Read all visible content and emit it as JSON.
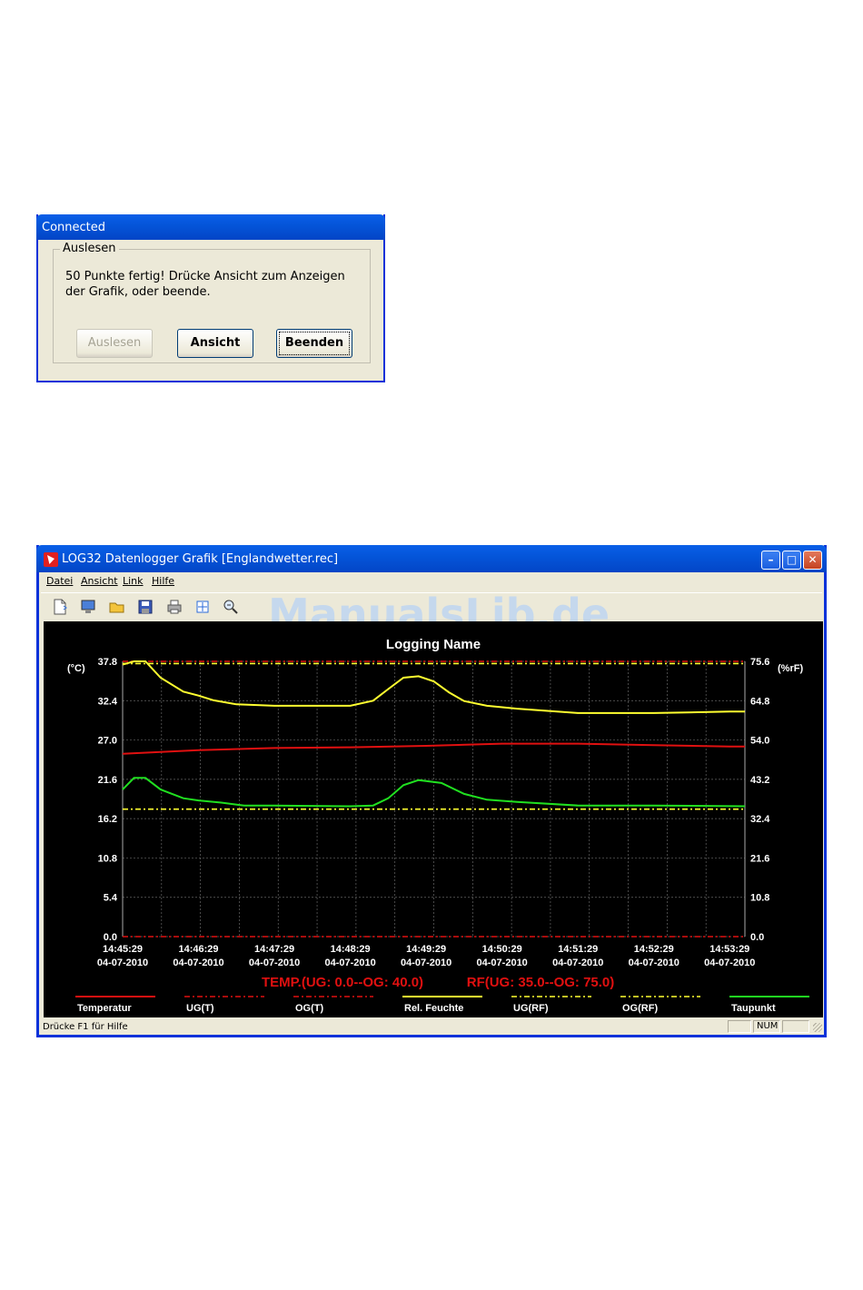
{
  "dialog": {
    "title": "Connected",
    "group_label": "Auslesen",
    "message": "50 Punkte fertig! Drücke Ansicht zum Anzeigen der Grafik, oder beende.",
    "buttons": {
      "read": "Auslesen",
      "view": "Ansicht",
      "exit": "Beenden"
    }
  },
  "window": {
    "title": "LOG32 Datenlogger Grafik [Englandwetter.rec]",
    "menu": [
      "Datei",
      "Ansicht",
      "Link",
      "Hilfe"
    ],
    "toolbar_icons": [
      "new-icon",
      "monitor-icon",
      "open-folder-icon",
      "save-disk-icon",
      "print-icon",
      "fit-view-icon",
      "zoom-icon"
    ],
    "watermark": "ManualsLib.de",
    "status": {
      "text": "Drücke F1 für Hilfe",
      "num": "NUM"
    }
  },
  "chart_data": {
    "type": "line",
    "title": "Logging Name",
    "left_unit": "(°C)",
    "right_unit": "(%rF)",
    "left_ticks": [
      "37.8",
      "32.4",
      "27.0",
      "21.6",
      "16.2",
      "10.8",
      "5.4",
      "0.0"
    ],
    "right_ticks": [
      "75.6",
      "64.8",
      "54.0",
      "43.2",
      "32.4",
      "21.6",
      "10.8",
      "0.0"
    ],
    "left_range": [
      0,
      37.8
    ],
    "right_range": [
      0,
      75.6
    ],
    "x_ticks": [
      {
        "time": "14:45:29",
        "date": "04-07-2010"
      },
      {
        "time": "14:46:29",
        "date": "04-07-2010"
      },
      {
        "time": "14:47:29",
        "date": "04-07-2010"
      },
      {
        "time": "14:48:29",
        "date": "04-07-2010"
      },
      {
        "time": "14:49:29",
        "date": "04-07-2010"
      },
      {
        "time": "14:50:29",
        "date": "04-07-2010"
      },
      {
        "time": "14:51:29",
        "date": "04-07-2010"
      },
      {
        "time": "14:52:29",
        "date": "04-07-2010"
      },
      {
        "time": "14:53:29",
        "date": "04-07-2010"
      }
    ],
    "x_minutes": [
      0,
      8.2
    ],
    "grid": true,
    "limits_text": {
      "temp": "TEMP.(UG: 0.0--OG: 40.0)",
      "rh": "RF(UG: 35.0--OG: 75.0)"
    },
    "series": [
      {
        "name": "Temperatur",
        "axis": "left",
        "color": "#e01010",
        "style": "solid",
        "x": [
          0,
          1,
          2,
          3,
          4,
          5,
          6,
          7,
          8,
          8.2
        ],
        "y": [
          25.1,
          25.6,
          25.9,
          26.0,
          26.2,
          26.5,
          26.5,
          26.3,
          26.1,
          26.1
        ]
      },
      {
        "name": "UG(T)",
        "axis": "left",
        "color": "#e01010",
        "style": "dashdot",
        "x": [
          0,
          8.2
        ],
        "y": [
          0.0,
          0.0
        ]
      },
      {
        "name": "OG(T)",
        "axis": "left",
        "color": "#e01010",
        "style": "dashdot",
        "x": [
          0,
          8.2
        ],
        "y": [
          40.0,
          40.0
        ]
      },
      {
        "name": "Rel. Feuchte",
        "axis": "right",
        "color": "#ffff30",
        "style": "solid",
        "x": [
          0,
          0.15,
          0.3,
          0.5,
          0.8,
          1.0,
          1.2,
          1.5,
          2.0,
          2.5,
          3.0,
          3.3,
          3.5,
          3.7,
          3.9,
          4.1,
          4.3,
          4.5,
          4.8,
          5.2,
          6.0,
          7.0,
          8.0,
          8.2
        ],
        "y": [
          74.7,
          77.4,
          76.5,
          71.1,
          67.3,
          66.2,
          64.9,
          63.8,
          63.4,
          63.4,
          63.4,
          64.8,
          68.0,
          71.1,
          71.5,
          70.1,
          67.1,
          64.7,
          63.4,
          62.6,
          61.4,
          61.4,
          61.8,
          61.8
        ]
      },
      {
        "name": "UG(RF)",
        "axis": "right",
        "color": "#ffff30",
        "style": "dashdot",
        "x": [
          0,
          8.2
        ],
        "y": [
          35.0,
          35.0
        ]
      },
      {
        "name": "OG(RF)",
        "axis": "right",
        "color": "#ffff30",
        "style": "dashdot",
        "x": [
          0,
          8.2
        ],
        "y": [
          75.0,
          75.0
        ]
      },
      {
        "name": "Taupunkt",
        "axis": "left",
        "color": "#20e020",
        "style": "solid",
        "x": [
          0,
          0.15,
          0.3,
          0.5,
          0.8,
          1.0,
          1.3,
          1.6,
          2.0,
          3.0,
          3.3,
          3.5,
          3.7,
          3.9,
          4.2,
          4.5,
          4.8,
          5.2,
          6.0,
          7.0,
          8.2
        ],
        "y": [
          20.2,
          21.8,
          21.8,
          20.2,
          19.0,
          18.7,
          18.4,
          18.0,
          18.0,
          17.9,
          18.0,
          19.0,
          20.8,
          21.5,
          21.1,
          19.6,
          18.8,
          18.5,
          18.0,
          18.0,
          17.9
        ]
      }
    ]
  }
}
